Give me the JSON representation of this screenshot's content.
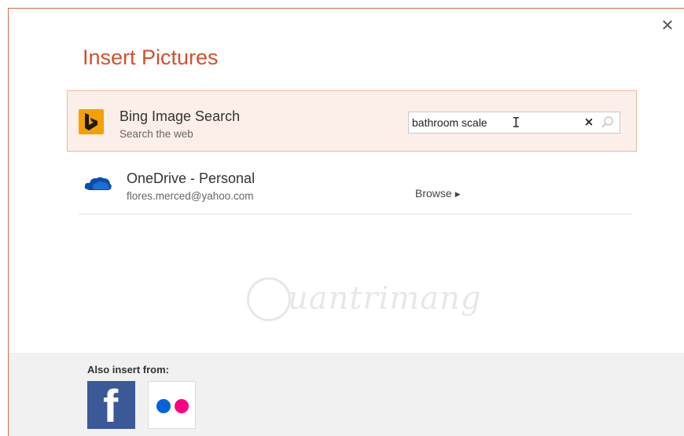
{
  "dialog": {
    "title": "Insert Pictures",
    "accent_color": "#d2502d"
  },
  "services": {
    "bing": {
      "name": "Bing Image Search",
      "subtitle": "Search the web",
      "icon": "bing-logo-icon",
      "search_value": "bathroom scale",
      "clear_label": "×"
    },
    "onedrive": {
      "name": "OneDrive - Personal",
      "subtitle": "flores.merced@yahoo.com",
      "icon": "onedrive-cloud-icon",
      "browse_label": "Browse"
    }
  },
  "footer": {
    "also_insert_label": "Also insert from:",
    "sources": [
      {
        "name": "Facebook",
        "icon": "facebook-icon",
        "color": "#3b5998"
      },
      {
        "name": "Flickr",
        "icon": "flickr-icon",
        "colors": [
          "#0063dc",
          "#ff0084"
        ]
      }
    ]
  }
}
